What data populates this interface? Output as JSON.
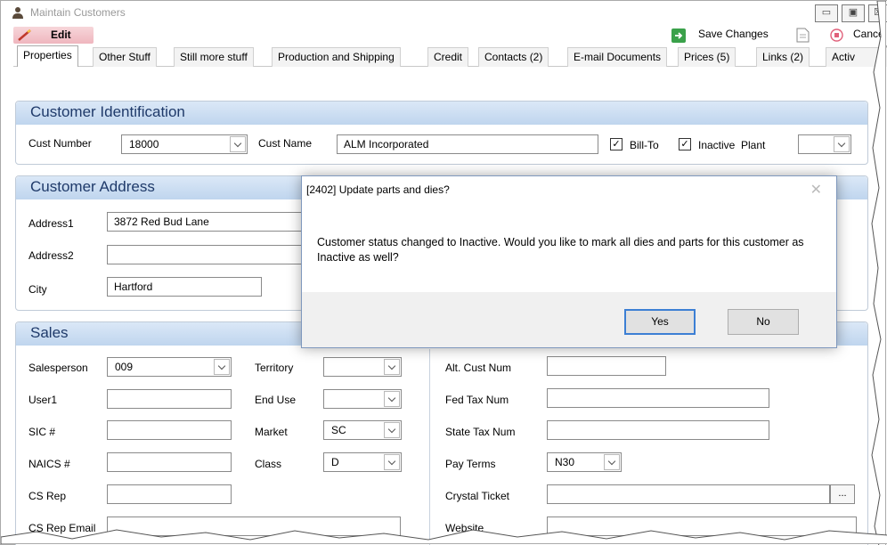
{
  "window": {
    "title": "Maintain Customers",
    "minimize_glyph": "▭",
    "maximize_glyph": "▣",
    "close_glyph": "☒"
  },
  "toolbar": {
    "edit_label": "Edit",
    "save_label": "Save Changes",
    "cancel_label": "Cance"
  },
  "tabs": [
    {
      "label": "Properties",
      "active": true
    },
    {
      "label": "Other Stuff"
    },
    {
      "label": "Still more stuff"
    },
    {
      "label": "Production and Shipping"
    },
    {
      "label": "Credit"
    },
    {
      "label": "Contacts (2)"
    },
    {
      "label": "E-mail Documents"
    },
    {
      "label": "Prices (5)"
    },
    {
      "label": "Links (2)"
    },
    {
      "label": "Activ"
    }
  ],
  "identification": {
    "title": "Customer Identification",
    "cust_number_label": "Cust Number",
    "cust_number": "18000",
    "cust_name_label": "Cust Name",
    "cust_name": "ALM Incorporated",
    "bill_to_label": "Bill-To",
    "bill_to_checked": true,
    "inactive_label": "Inactive",
    "inactive_checked": true,
    "plant_label": "Plant",
    "plant": ""
  },
  "address": {
    "title": "Customer Address",
    "address1_label": "Address1",
    "address1": "3872 Red Bud Lane",
    "address2_label": "Address2",
    "address2": "",
    "city_label": "City",
    "city": "Hartford"
  },
  "sales": {
    "title": "Sales",
    "salesperson_label": "Salesperson",
    "salesperson": "009",
    "user1_label": "User1",
    "sic_label": "SIC #",
    "naics_label": "NAICS #",
    "csrep_label": "CS Rep",
    "csrep_email_label": "CS Rep Email",
    "territory_label": "Territory",
    "enduse_label": "End Use",
    "market_label": "Market",
    "market": "SC",
    "class_label": "Class",
    "class": "D",
    "alt_cust_label": "Alt. Cust Num",
    "fed_tax_label": "Fed Tax Num",
    "state_tax_label": "State Tax Num",
    "pay_terms_label": "Pay Terms",
    "pay_terms": "N30",
    "crystal_label": "Crystal Ticket",
    "ellipsis": "...",
    "website_label": "Website"
  },
  "dialog": {
    "title": "[2402] Update parts and dies?",
    "close": "✕",
    "message": "Customer status changed to Inactive. Would you like to mark all dies and parts for this customer as Inactive as well?",
    "yes_label": "Yes",
    "no_label": "No"
  },
  "colors": {
    "group_header": "#c8dbf1",
    "accent_blue": "#3c7fd4",
    "edit_pink": "#f2c4cb"
  }
}
